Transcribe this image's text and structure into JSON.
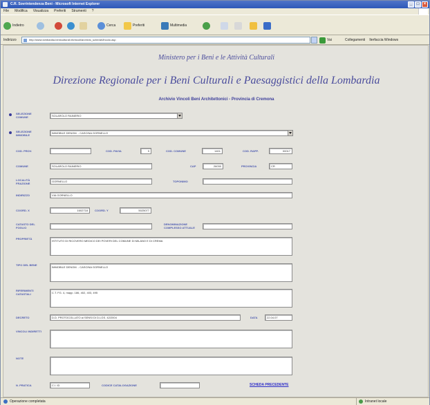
{
  "window": {
    "title": "C.R. Sovrintendenza Beni - Microsoft Internet Explorer",
    "min": "_",
    "max": "□",
    "close": "×"
  },
  "menu": [
    "File",
    "Modifica",
    "Visualizza",
    "Preferiti",
    "Strumenti",
    "?"
  ],
  "toolbar": {
    "back": "Indietro",
    "search": "Cerca",
    "favorites": "Preferiti",
    "media": "Multimedia"
  },
  "address": {
    "label": "Indirizzo",
    "url": "http://www.lombardia.beniculturali.it/vincoli/archivio_schedaVincolo.asp",
    "go": "Vai",
    "links": [
      "Collegamenti",
      "Iterfaccia Windows"
    ]
  },
  "page": {
    "ministry": "Ministero per i Beni e le Attività Culturali",
    "direction": "Direzione Regionale per i Beni Culturali e Paesaggistici  della Lombardia",
    "archive": "Archivio Vincoli Beni Architettonici - Provincia di Cremona"
  },
  "form": {
    "comune_label": "Selezione Comune",
    "comune_value": "SOLAROLO RAINERIO",
    "immobile_label": "Selezione Immobile",
    "immobile_value": "IMMOBILE DENOM. - CASCINA GORNELLO",
    "cod_prov_label": "Cod. Prov.",
    "cod_prov_value": "",
    "cod_pavia_label": "Cod. Pavia",
    "cod_pavia_value": "9",
    "cod_comune_label": "Cod. Comune",
    "cod_comune_value": "1401",
    "cod_rapp_label": "Cod. Rapp.",
    "cod_rapp_value": "00017",
    "comune_field_label": "Comune",
    "comune_field_value": "SOLAROLO RAINERIO",
    "cap_label": "CAP",
    "cap_value": "26030",
    "provincia_label": "Provincia",
    "provincia_value": "CR",
    "localita_label": "Località Frazione",
    "localita_value": "GORNELLO",
    "toponimo_label": "Toponimo",
    "toponimo_value": "",
    "indirizzo_label": "Indirizzo",
    "indirizzo_value": "VIA GORNELLO",
    "coord_x_label": "Coord. X",
    "coord_x_value": "1602718",
    "coord_y_label": "Coord. Y",
    "coord_y_value": "5025077",
    "catasto_label": "Catasto del Foglio",
    "catasto_value": "",
    "denominazione_label": "Denominazione Complesso Attuale",
    "denominazione_value": "",
    "proprieta_label": "Proprietà",
    "proprieta_value": "ISTITUTO DI RICOVERO MEDICO DEI POVERI DEL COMUNE DI MILANO E DI CREMA",
    "tipo_label": "Tipo del Bene",
    "tipo_value": "IMMOBILE DENOM. - CASCINA GORNELLO",
    "riferimenti_label": "Riferimenti Catastali",
    "riferimenti_value": "C.T. FG. 4,  mapp. 186, 402, 403, 495",
    "decreto_label": "Decreto",
    "decreto_value": "D.D. PROTOCOLLATO ai SENSI DI D.LGS. 42/2004",
    "data_label": "Data",
    "data_value": "22.04.07",
    "vincoli_label": "Vincoli Indiretti",
    "vincoli_value": "",
    "note_label": "Note",
    "note_value": "",
    "n_pratica_label": "N. Pratica",
    "n_pratica_value": "C.I. ID",
    "codice_label": "Codice Catalogazione",
    "codice_value": "",
    "send_link": "SCHEDA PRECEDENTE"
  },
  "status": {
    "left": "Operazione completata",
    "right": "Intranet locale"
  }
}
